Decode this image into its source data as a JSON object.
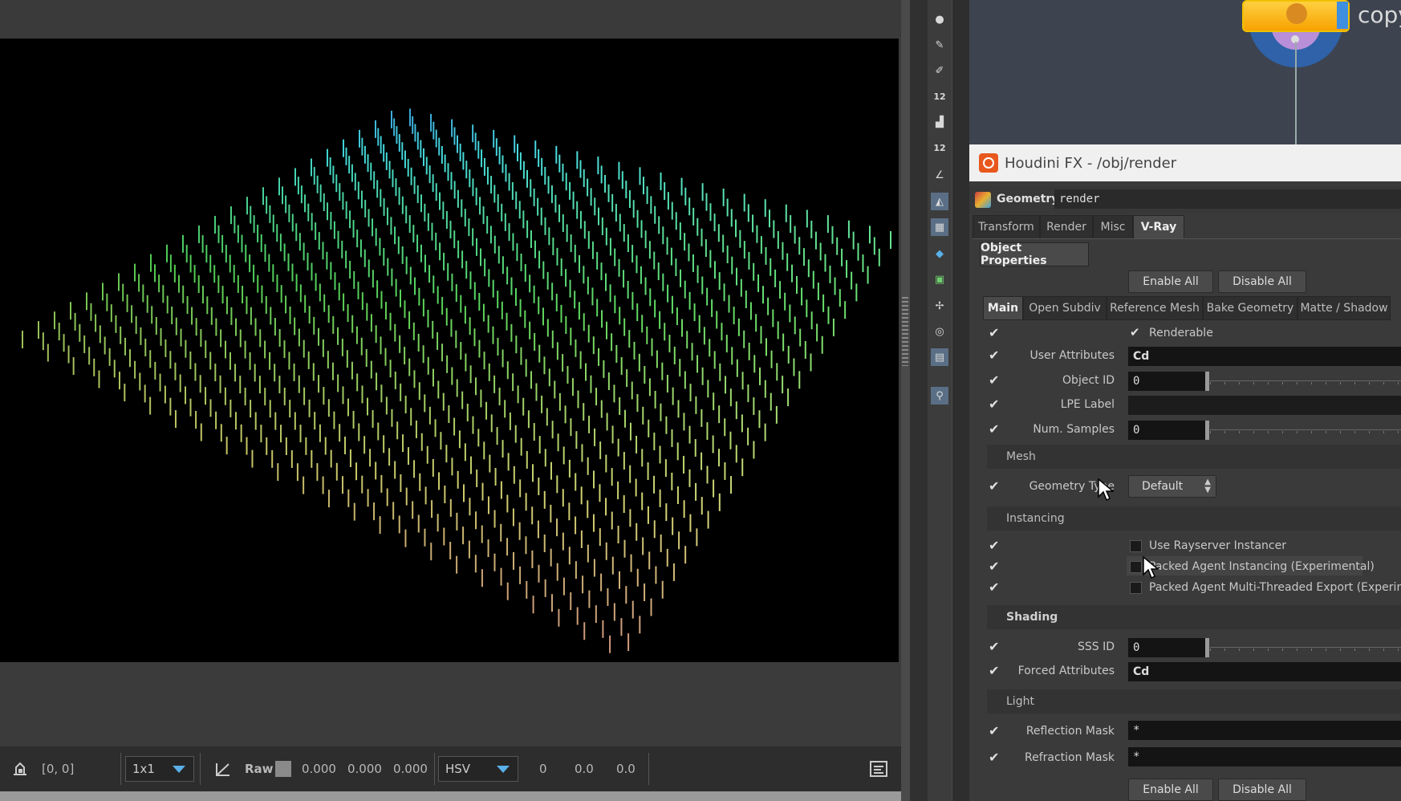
{
  "viewer": {
    "pixel_coords": "[0, 0]",
    "zoom_option": "1x1",
    "raw_label": "Raw",
    "rgb_values": [
      "0.000",
      "0.000",
      "0.000"
    ],
    "color_mode": "HSV",
    "hsv_values": [
      "0",
      "0.0",
      "0.0"
    ]
  },
  "network": {
    "node_label": "copy"
  },
  "window": {
    "title": "Houdini FX - /obj/render"
  },
  "node": {
    "type_label": "Geometry",
    "name": "render"
  },
  "top_tabs": [
    {
      "label": "Transform",
      "active": false
    },
    {
      "label": "Render",
      "active": false
    },
    {
      "label": "Misc",
      "active": false
    },
    {
      "label": "V-Ray",
      "active": true
    }
  ],
  "panel_tab": "Object Properties",
  "enable_all": "Enable All",
  "disable_all": "Disable All",
  "sub_tabs": [
    {
      "label": "Main",
      "active": true
    },
    {
      "label": "Open Subdiv",
      "active": false
    },
    {
      "label": "Reference Mesh",
      "active": false
    },
    {
      "label": "Bake Geometry",
      "active": false
    },
    {
      "label": "Matte / Shadow",
      "active": false
    }
  ],
  "params": {
    "renderable": "Renderable",
    "user_attributes": {
      "label": "User Attributes",
      "value": "Cd"
    },
    "object_id": {
      "label": "Object ID",
      "value": "0"
    },
    "lpe_label": {
      "label": "LPE Label",
      "value": ""
    },
    "num_samples": {
      "label": "Num. Samples",
      "value": "0"
    },
    "mesh_section": "Mesh",
    "geometry_type": {
      "label": "Geometry Type",
      "value": "Default"
    },
    "instancing_section": "Instancing",
    "use_rayserver": "Use Rayserver Instancer",
    "packed_agent": "Packed Agent Instancing (Experimental)",
    "packed_agent_mt": "Packed Agent Multi-Threaded Export (Experiment",
    "shading_section": "Shading",
    "sss_id": {
      "label": "SSS ID",
      "value": "0"
    },
    "forced_attributes": {
      "label": "Forced Attributes",
      "value": "Cd"
    },
    "light_section": "Light",
    "reflection_mask": {
      "label": "Reflection Mask",
      "value": "*"
    },
    "refraction_mask": {
      "label": "Refraction Mask",
      "value": "*"
    }
  },
  "colors": {
    "accent": "#5ab0e8",
    "node": "#f6a200",
    "viewer_bg": "#000000"
  }
}
